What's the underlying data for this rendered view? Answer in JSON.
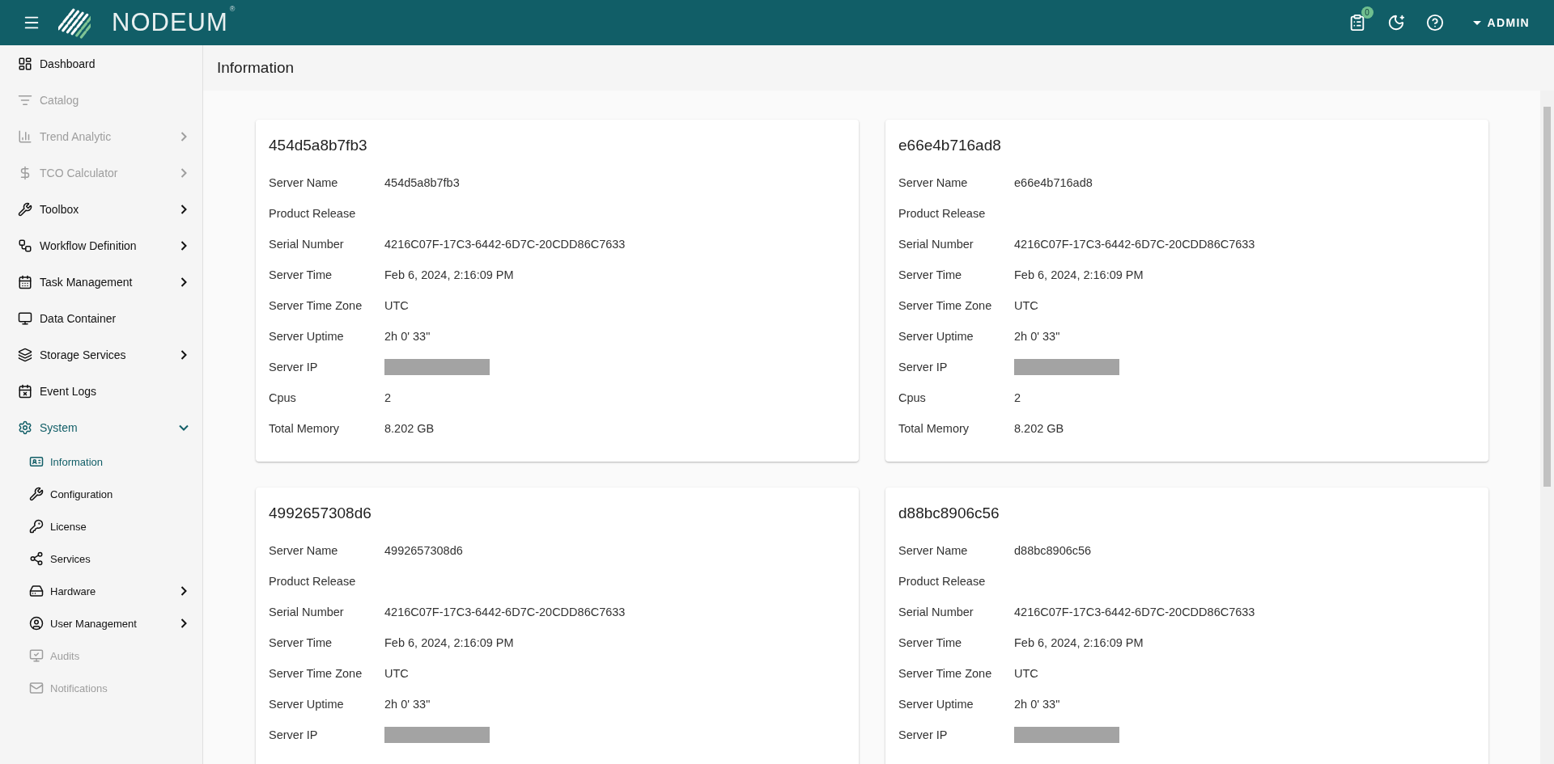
{
  "header": {
    "logo": {
      "text": "NODEUM",
      "mark": "®"
    },
    "tasks_badge": "0",
    "user": "ADMIN"
  },
  "sidebar": {
    "items": [
      {
        "label": "Dashboard",
        "disabled": false
      },
      {
        "label": "Catalog",
        "disabled": true
      },
      {
        "label": "Trend Analytic",
        "disabled": true,
        "expanded": false
      },
      {
        "label": "TCO Calculator",
        "disabled": true,
        "expanded": false
      },
      {
        "label": "Toolbox",
        "disabled": false,
        "expanded": false
      },
      {
        "label": "Workflow Definition",
        "disabled": false,
        "expanded": false
      },
      {
        "label": "Task Management",
        "disabled": false,
        "expanded": false
      },
      {
        "label": "Data Container",
        "disabled": false
      },
      {
        "label": "Storage Services",
        "disabled": false,
        "expanded": false
      },
      {
        "label": "Event Logs",
        "disabled": false
      },
      {
        "label": "System",
        "disabled": false,
        "expanded": true,
        "children": [
          {
            "label": "Information",
            "disabled": false,
            "selected": true
          },
          {
            "label": "Configuration",
            "disabled": false,
            "selected": false
          },
          {
            "label": "License",
            "disabled": false,
            "selected": false
          },
          {
            "label": "Services",
            "disabled": false,
            "selected": false
          },
          {
            "label": "Hardware",
            "disabled": false,
            "selected": false,
            "expanded": false
          },
          {
            "label": "User Management",
            "disabled": false,
            "selected": false,
            "expanded": false
          },
          {
            "label": "Audits",
            "disabled": true,
            "selected": false
          },
          {
            "label": "Notifications",
            "disabled": true,
            "selected": false
          }
        ]
      }
    ]
  },
  "page": {
    "title": "Information"
  },
  "servers": [
    {
      "title": "454d5a8b7fb3",
      "rows": [
        {
          "label": "Server Name",
          "kind": "text",
          "value": "454d5a8b7fb3"
        },
        {
          "label": "Product Release",
          "kind": "text"
        },
        {
          "label": "Serial Number",
          "kind": "text",
          "value": "4216C07F-17C3-6442-6D7C-20CDD86C7633"
        },
        {
          "label": "Server Time",
          "kind": "text",
          "value": "Feb 6, 2024, 2:16:09 PM"
        },
        {
          "label": "Server Time Zone",
          "kind": "text",
          "value": "UTC"
        },
        {
          "label": "Server Uptime",
          "kind": "text",
          "value": "2h 0' 33\""
        },
        {
          "label": "Server IP",
          "kind": "redacted"
        },
        {
          "label": "Cpus",
          "kind": "text",
          "value": "2"
        },
        {
          "label": "Total Memory",
          "kind": "text",
          "value": "8.202 GB"
        }
      ]
    },
    {
      "title": "e66e4b716ad8",
      "rows": [
        {
          "label": "Server Name",
          "kind": "text",
          "value": "e66e4b716ad8"
        },
        {
          "label": "Product Release",
          "kind": "text"
        },
        {
          "label": "Serial Number",
          "kind": "text",
          "value": "4216C07F-17C3-6442-6D7C-20CDD86C7633"
        },
        {
          "label": "Server Time",
          "kind": "text",
          "value": "Feb 6, 2024, 2:16:09 PM"
        },
        {
          "label": "Server Time Zone",
          "kind": "text",
          "value": "UTC"
        },
        {
          "label": "Server Uptime",
          "kind": "text",
          "value": "2h 0' 33\""
        },
        {
          "label": "Server IP",
          "kind": "redacted"
        },
        {
          "label": "Cpus",
          "kind": "text",
          "value": "2"
        },
        {
          "label": "Total Memory",
          "kind": "text",
          "value": "8.202 GB"
        }
      ]
    },
    {
      "title": "4992657308d6",
      "rows": [
        {
          "label": "Server Name",
          "kind": "text",
          "value": "4992657308d6"
        },
        {
          "label": "Product Release",
          "kind": "text"
        },
        {
          "label": "Serial Number",
          "kind": "text",
          "value": "4216C07F-17C3-6442-6D7C-20CDD86C7633"
        },
        {
          "label": "Server Time",
          "kind": "text",
          "value": "Feb 6, 2024, 2:16:09 PM"
        },
        {
          "label": "Server Time Zone",
          "kind": "text",
          "value": "UTC"
        },
        {
          "label": "Server Uptime",
          "kind": "text",
          "value": "2h 0' 33\""
        },
        {
          "label": "Server IP",
          "kind": "redacted"
        }
      ]
    },
    {
      "title": "d88bc8906c56",
      "rows": [
        {
          "label": "Server Name",
          "kind": "text",
          "value": "d88bc8906c56"
        },
        {
          "label": "Product Release",
          "kind": "text"
        },
        {
          "label": "Serial Number",
          "kind": "text",
          "value": "4216C07F-17C3-6442-6D7C-20CDD86C7633"
        },
        {
          "label": "Server Time",
          "kind": "text",
          "value": "Feb 6, 2024, 2:16:09 PM"
        },
        {
          "label": "Server Time Zone",
          "kind": "text",
          "value": "UTC"
        },
        {
          "label": "Server Uptime",
          "kind": "text",
          "value": "2h 0' 33\""
        },
        {
          "label": "Server IP",
          "kind": "redacted"
        }
      ]
    }
  ]
}
